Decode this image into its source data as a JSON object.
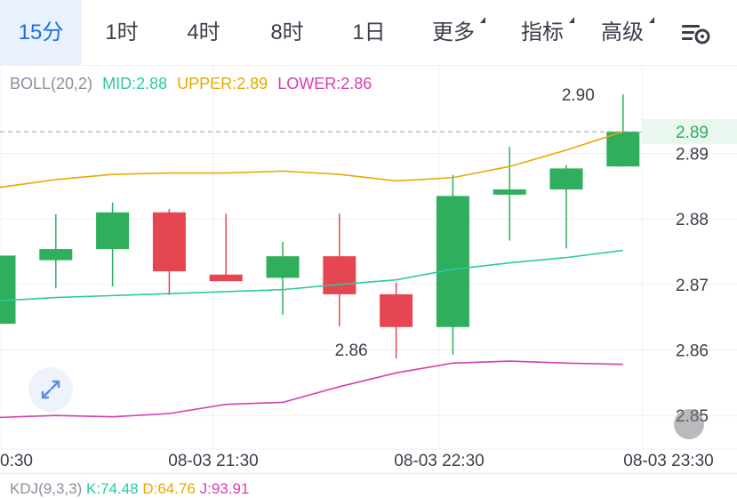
{
  "tabs": [
    {
      "label": "15分",
      "active": true
    },
    {
      "label": "1时"
    },
    {
      "label": "4时"
    },
    {
      "label": "8时"
    },
    {
      "label": "1日"
    },
    {
      "label": "更多",
      "dropdown": true
    },
    {
      "label": "指标",
      "dropdown": true
    },
    {
      "label": "高级",
      "dropdown": true
    }
  ],
  "settings_icon": "chart-settings-icon",
  "expand_icon": "expand-arrows-icon",
  "boll": {
    "title": "BOLL(20,2)",
    "mid": "MID:2.88",
    "upper": "UPPER:2.89",
    "lower": "LOWER:2.86",
    "colors": {
      "title": "#8a8f99",
      "mid": "#2cc9a6",
      "upper": "#e6a800",
      "lower": "#d63fb0"
    }
  },
  "kdj": {
    "title": "KDJ(9,3,3)",
    "k": "K:74.48",
    "d": "D:64.76",
    "j": "J:93.91"
  },
  "colors": {
    "up": "#2fae5b",
    "down": "#e64552",
    "grid": "#eef0f3",
    "axis_text": "#3a3f4a"
  },
  "chart_data": {
    "type": "candlestick",
    "y_ticks": [
      "2.89",
      "2.88",
      "2.87",
      "2.86",
      "2.85"
    ],
    "x_ticks": [
      "0:30",
      "08-03 21:30",
      "08-03 22:30",
      "08-03 23:30"
    ],
    "last_price": "2.89",
    "high_marker": "2.90",
    "low_marker": "2.86",
    "ylim": [
      2.8465,
      2.9035
    ],
    "candles": [
      {
        "o": 2.864,
        "c": 2.8744,
        "h": 2.8744,
        "l": 2.864
      },
      {
        "o": 2.8737,
        "c": 2.8754,
        "h": 2.8807,
        "l": 2.8694
      },
      {
        "o": 2.8754,
        "c": 2.881,
        "h": 2.8825,
        "l": 2.8697
      },
      {
        "o": 2.881,
        "c": 2.872,
        "h": 2.8815,
        "l": 2.8684
      },
      {
        "o": 2.8715,
        "c": 2.8705,
        "h": 2.8808,
        "l": 2.8705
      },
      {
        "o": 2.871,
        "c": 2.8743,
        "h": 2.8765,
        "l": 2.8654
      },
      {
        "o": 2.8743,
        "c": 2.8685,
        "h": 2.8808,
        "l": 2.8636
      },
      {
        "o": 2.8685,
        "c": 2.8635,
        "h": 2.8703,
        "l": 2.8587
      },
      {
        "o": 2.8635,
        "c": 2.8835,
        "h": 2.8867,
        "l": 2.8593
      },
      {
        "o": 2.8837,
        "c": 2.8845,
        "h": 2.891,
        "l": 2.8767
      },
      {
        "o": 2.8845,
        "c": 2.8877,
        "h": 2.8882,
        "l": 2.8755
      },
      {
        "o": 2.888,
        "c": 2.8933,
        "h": 2.899,
        "l": 2.888
      }
    ],
    "bands": {
      "upper": [
        2.8848,
        2.886,
        2.8868,
        2.887,
        2.887,
        2.8873,
        2.8868,
        2.8858,
        2.8863,
        2.888,
        2.8905,
        2.8933
      ],
      "mid": [
        2.8675,
        2.868,
        2.8683,
        2.8686,
        2.8689,
        2.8692,
        2.87,
        2.8707,
        2.8723,
        2.8733,
        2.8741,
        2.8752
      ],
      "lower": [
        2.8497,
        2.85,
        2.8498,
        2.8503,
        2.8517,
        2.852,
        2.8544,
        2.8565,
        2.858,
        2.8583,
        2.858,
        2.8578
      ]
    }
  }
}
